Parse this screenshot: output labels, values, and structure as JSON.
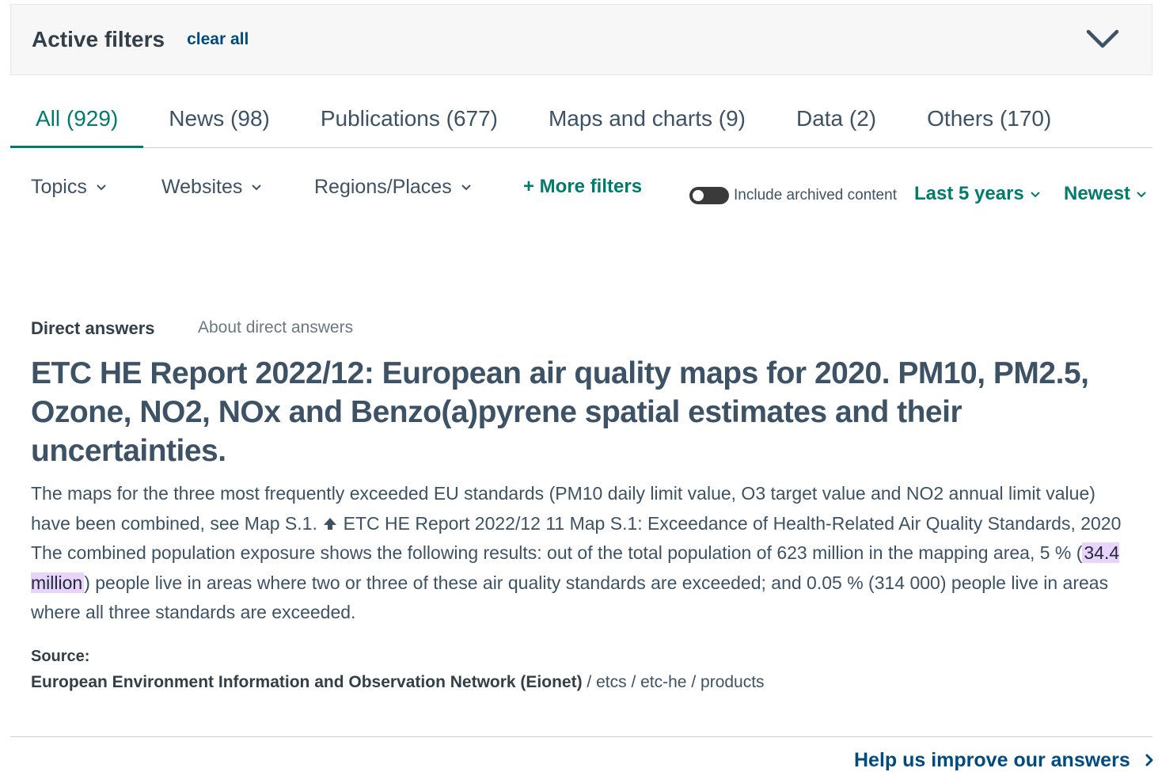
{
  "active_filters": {
    "title": "Active filters",
    "clear_all": "clear all"
  },
  "tabs": [
    {
      "label": "All (929)",
      "active": true
    },
    {
      "label": "News (98)"
    },
    {
      "label": "Publications (677)"
    },
    {
      "label": "Maps and charts (9)"
    },
    {
      "label": "Data (2)"
    },
    {
      "label": "Others (170)"
    }
  ],
  "toolbar": {
    "topics": "Topics",
    "websites": "Websites",
    "regions": "Regions/Places",
    "more_filters": "+ More filters",
    "archived_toggle_label": "Include archived content",
    "archived_toggle_on": false,
    "time_range": "Last 5 years",
    "sort": "Newest"
  },
  "direct_answers": {
    "label": "Direct answers",
    "about": "About direct answers",
    "title": "ETC HE Report 2022/12: European air quality maps for 2020. PM10, PM2.5, Ozone, NO2, NOx and Benzo(a)pyrene spatial estimates and their uncertainties.",
    "body_before_arrow": "The maps for the three most frequently exceeded EU standards (PM10 daily limit value, O3 target value and NO2 annual limit value) have been combined, see Map S.1. ",
    "body_after_arrow": " ETC HE Report 2022/12 11 Map S.1: Exceedance of Health-Related Air Quality Standards, 2020 The combined population exposure shows the following results: out of the total population of 623 million in the mapping area, 5 % (",
    "highlight": "34.4 million",
    "body_end": ") people live in areas where two or three of these air quality standards are exceeded; and 0.05 % (314 000) people live in areas where all three standards are exceeded.",
    "source_label": "Source:",
    "source_org": "European Environment Information and Observation Network (Eionet)",
    "source_path": [
      "etcs",
      "etc-he",
      "products"
    ],
    "source_sep": " / "
  },
  "help_link": "Help us improve our answers",
  "colors": {
    "accent_green": "#007b6c",
    "link_blue": "#004b7f",
    "highlight": "#e9d4fb",
    "text": "#3d5265"
  },
  "icons": [
    "chevron-down-icon",
    "up-arrow-icon",
    "chevron-right-icon"
  ]
}
